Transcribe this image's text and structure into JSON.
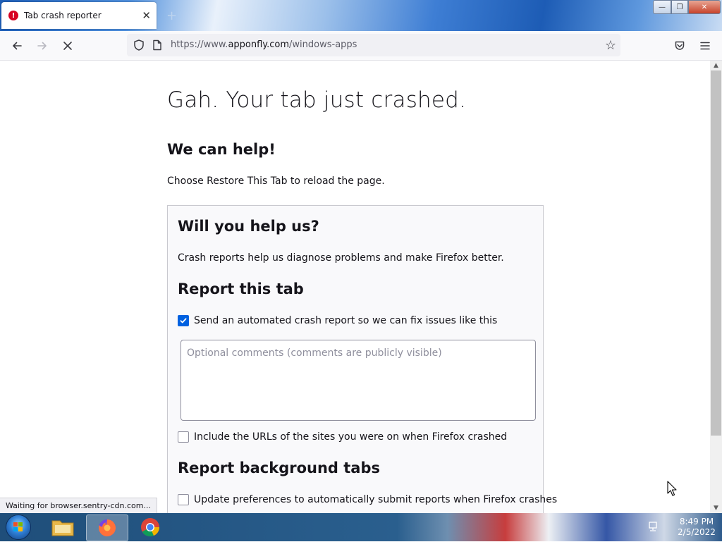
{
  "browser": {
    "tab": {
      "title": "Tab crash reporter",
      "close": "✕"
    },
    "new_tab": "+",
    "window_controls": {
      "minimize": "—",
      "maximize": "❐",
      "close": "✕"
    },
    "url": {
      "prefix": "https://www.",
      "domain": "apponfly.com",
      "path": "/windows-apps"
    },
    "status_text": "Waiting for browser.sentry-cdn.com..."
  },
  "page": {
    "title": "Gah. Your tab just crashed.",
    "help_heading": "We can help!",
    "restore_text": "Choose Restore This Tab to reload the page.",
    "panel": {
      "heading": "Will you help us?",
      "description": "Crash reports help us diagnose problems and make Firefox better.",
      "report_heading": "Report this tab",
      "send_report_label": "Send an automated crash report so we can fix issues like this",
      "send_report_checked": true,
      "comments_placeholder": "Optional comments (comments are publicly visible)",
      "include_urls_label": "Include the URLs of the sites you were on when Firefox crashed",
      "include_urls_checked": false,
      "background_heading": "Report background tabs",
      "auto_submit_label": "Update preferences to automatically submit reports when Firefox crashes",
      "auto_submit_checked": false
    }
  },
  "taskbar": {
    "time": "8:49 PM",
    "date": "2/5/2022"
  },
  "colors": {
    "accent": "#0061e0",
    "crash_red": "#d70022"
  }
}
